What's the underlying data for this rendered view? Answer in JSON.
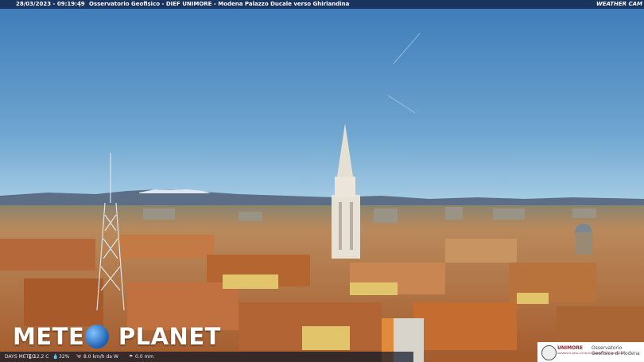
{
  "header": {
    "datetime": "28/03/2023 - 09:19:49",
    "separator": "|",
    "caption": "Osservatorio Geofisico - DIEF UNIMORE - Modena Palazzo Ducale verso Ghirlandina",
    "logo": "WEATHER CAM"
  },
  "brand": {
    "left": "METE",
    "right": "PLANET",
    "globe_icon": "globe-icon"
  },
  "status": {
    "station": "DAYS METEO",
    "temperature": "12.2 C",
    "humidity": "32%",
    "wind": "8.0 km/h da W",
    "rain": "0.0 mm"
  },
  "station_logo": {
    "university": "UNIMORE",
    "department": "UNIVERSITÀ DEGLI STUDI DI MODENA E REGGIO EMILIA",
    "observatory": "Osservatorio Geofisico di Modena"
  },
  "colors": {
    "sky_top": "#3c7ab8",
    "sky_bottom": "#a9cfe6",
    "roofs": "#b8703a",
    "tower": "#e8e2d6"
  }
}
